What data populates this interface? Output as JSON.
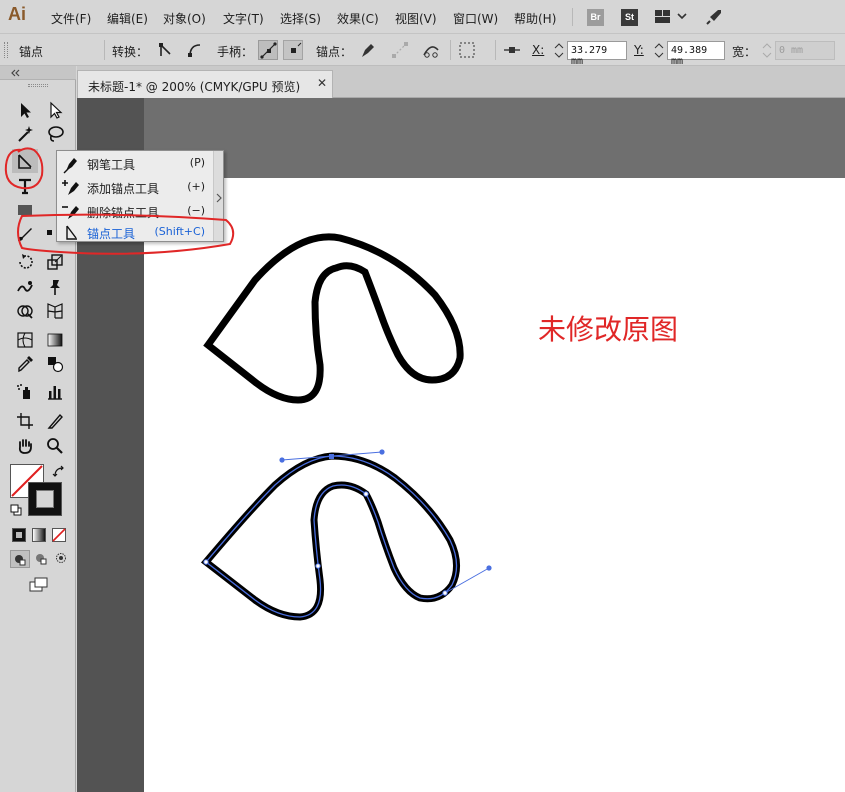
{
  "app": {
    "logo": "Ai",
    "menus": [
      "文件(F)",
      "编辑(E)",
      "对象(O)",
      "文字(T)",
      "选择(S)",
      "效果(C)",
      "视图(V)",
      "窗口(W)",
      "帮助(H)"
    ],
    "bridge_badge": "Br",
    "stock_badge": "St"
  },
  "controlbar": {
    "tool_name": "锚点",
    "convert_label": "转换：",
    "handle_label": "手柄：",
    "anchor_label": "锚点：",
    "x_label": "X:",
    "x_value": "33.279 mm",
    "y_label": "Y:",
    "y_value": "49.389 mm",
    "w_label": "宽：",
    "w_value": "0 mm"
  },
  "document": {
    "tab_title": "未标题-1* @ 200% (CMYK/GPU 预览)",
    "close_glyph": "✕"
  },
  "flyout": {
    "items": [
      {
        "label": "钢笔工具",
        "shortcut": "(P)",
        "icon": "pen-icon"
      },
      {
        "label": "添加锚点工具",
        "shortcut": "(+)",
        "icon": "add-anchor-icon"
      },
      {
        "label": "删除锚点工具",
        "shortcut": "(−)",
        "icon": "delete-anchor-icon"
      },
      {
        "label": "锚点工具",
        "shortcut": "(Shift+C)",
        "icon": "anchor-point-icon",
        "active": true
      }
    ]
  },
  "annotation": {
    "text": "未修改原图",
    "color": "#e02727"
  },
  "colors": {
    "accent_blue": "#1a62d6",
    "selection_blue": "#4a6fe0",
    "annotation_red": "#e02727"
  }
}
